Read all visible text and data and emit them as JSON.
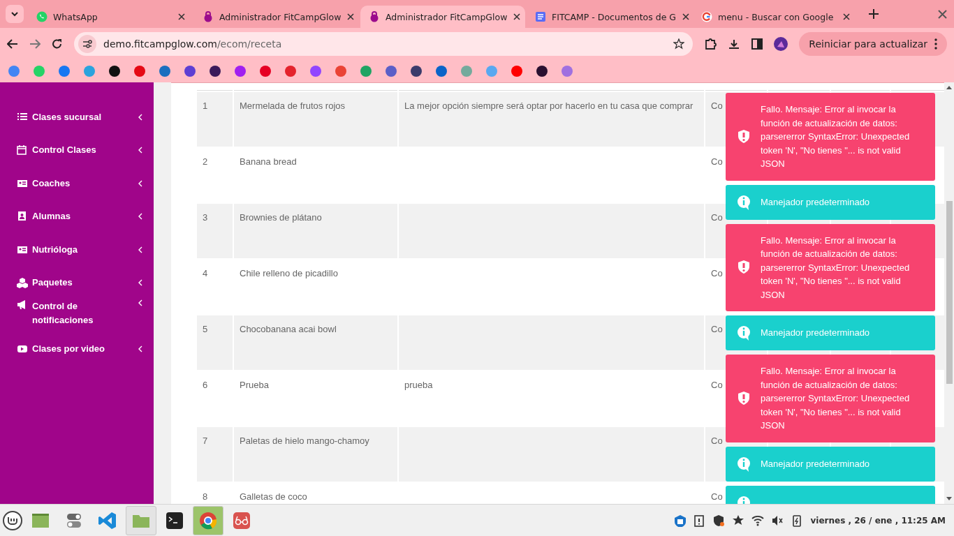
{
  "browser": {
    "tabs": [
      {
        "kind": "chat",
        "title": "WhatsApp",
        "selected": false
      },
      {
        "kind": "kettlebell",
        "title": "Administrador FitCampGlow",
        "selected": false
      },
      {
        "kind": "kettlebell",
        "title": "Administrador FitCampGlow",
        "selected": true
      },
      {
        "kind": "document",
        "title": "FITCAMP - Documentos de G",
        "selected": false
      },
      {
        "kind": "search",
        "title": "menu - Buscar con Google",
        "selected": false
      }
    ],
    "address": {
      "host": "demo.fitcampglow.com",
      "path": "/ecom/receta"
    },
    "update_button": "Reiniciar para actualizar",
    "bookmarks": [
      {
        "color": "#4285f4"
      },
      {
        "color": "#25d366"
      },
      {
        "color": "#1877f2"
      },
      {
        "color": "#2aa3dd"
      },
      {
        "color": "#111111"
      },
      {
        "color": "#e50914"
      },
      {
        "color": "#1b6fbf"
      },
      {
        "color": "#5d3fd3"
      },
      {
        "color": "#3b1a5a"
      },
      {
        "color": "#a020f0"
      },
      {
        "color": "#e60023"
      },
      {
        "color": "#e4232c"
      },
      {
        "color": "#9146ff"
      },
      {
        "color": "#ea4335"
      },
      {
        "color": "#1fa463"
      },
      {
        "color": "#5b5fc7"
      },
      {
        "color": "#3b3b6b"
      },
      {
        "color": "#0a64c8"
      },
      {
        "color": "#74aa9c"
      },
      {
        "color": "#59a8f0"
      },
      {
        "color": "#ff0000"
      },
      {
        "color": "#2a1030"
      },
      {
        "color": "#a070e0"
      }
    ]
  },
  "sidebar": {
    "items": [
      {
        "kind": "list",
        "label": "Clases sucursal"
      },
      {
        "kind": "calendar",
        "label": "Control Clases"
      },
      {
        "kind": "card",
        "label": "Coaches"
      },
      {
        "kind": "person",
        "label": "Alumnas"
      },
      {
        "kind": "card",
        "label": "Nutrióloga"
      },
      {
        "kind": "boxes",
        "label": "Paquetes"
      },
      {
        "kind": "megaphone",
        "label": "Control de notificaciones"
      },
      {
        "kind": "video",
        "label": "Clases por video"
      }
    ]
  },
  "table": {
    "rows": [
      {
        "number": "1",
        "name": "Mermelada de frutos rojos",
        "description": "La mejor opción siempre será optar por hacerlo en tu casa que comprar",
        "column_4": "Co"
      },
      {
        "number": "2",
        "name": "Banana bread",
        "column_4": "Co"
      },
      {
        "number": "3",
        "name": "Brownies de plátano",
        "column_4": "Co"
      },
      {
        "number": "4",
        "name": "Chile relleno de picadillo",
        "column_4": "Co"
      },
      {
        "number": "5",
        "name": "Chocobanana acai bowl",
        "column_4": "Co"
      },
      {
        "number": "6",
        "name": "Prueba",
        "description": "prueba",
        "column_4": "Co"
      },
      {
        "number": "7",
        "name": "Paletas de hielo mango-chamoy",
        "column_4": "Co"
      },
      {
        "number": "8",
        "name": "Galletas de coco",
        "column_4": "Co"
      }
    ]
  },
  "toasts": [
    {
      "kind": "error",
      "message": "Fallo. Mensaje: Error al invocar la función de actualización de datos: parsererror SyntaxError: Unexpected token 'N', \"No tienes \"... is not valid JSON"
    },
    {
      "kind": "info",
      "message": "Manejador predeterminado"
    },
    {
      "kind": "error",
      "message": "Fallo. Mensaje: Error al invocar la función de actualización de datos: parsererror SyntaxError: Unexpected token 'N', \"No tienes \"... is not valid JSON"
    },
    {
      "kind": "info",
      "message": "Manejador predeterminado"
    },
    {
      "kind": "error",
      "message": "Fallo. Mensaje: Error al invocar la función de actualización de datos: parsererror SyntaxError: Unexpected token 'N', \"No tienes \"... is not valid JSON"
    },
    {
      "kind": "info",
      "message": "Manejador predeterminado"
    },
    {
      "kind": "info"
    }
  ],
  "taskbar": {
    "apps": [
      {
        "kind": "files",
        "active": false
      },
      {
        "kind": "toggle",
        "active": false
      },
      {
        "kind": "code",
        "active": false
      },
      {
        "kind": "folder",
        "active": true
      },
      {
        "kind": "terminal",
        "active": false
      },
      {
        "kind": "browser",
        "active": true
      },
      {
        "kind": "glasses",
        "active": false
      }
    ],
    "clock": "viernes , 26 / ene , 11:25 AM"
  }
}
